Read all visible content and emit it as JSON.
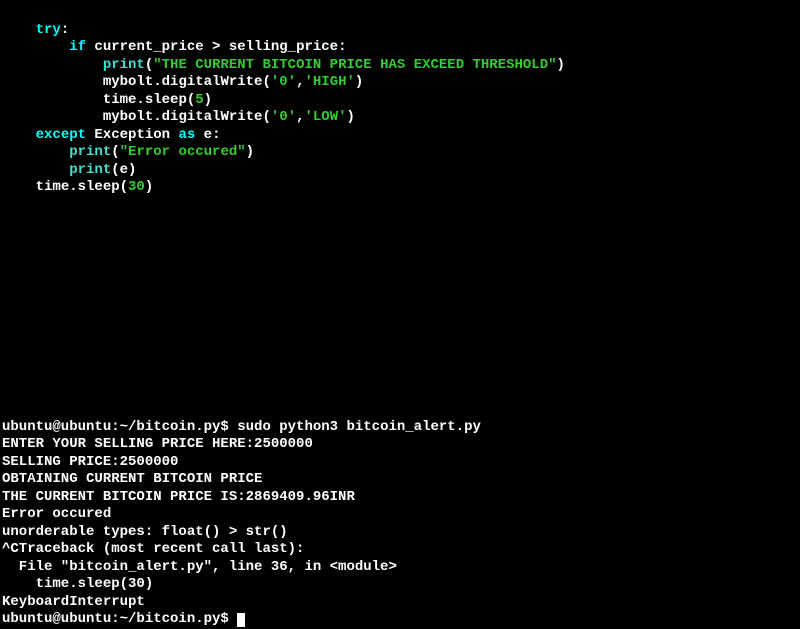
{
  "code": {
    "indent1": "    ",
    "indent2": "        ",
    "indent3": "            ",
    "try": "try",
    "colon": ":",
    "if": "if",
    "cond": " current_price > selling_price:",
    "print": "print",
    "lp": "(",
    "rp": ")",
    "msg": "\"THE CURRENT BITCOIN PRICE HAS EXCEED THRESHOLD\"",
    "dw1a": "mybolt.digitalWrite(",
    "zero": "'0'",
    "comma": ",",
    "high": "'HIGH'",
    "low": "'LOW'",
    "sleep5a": "time.sleep(",
    "five": "5",
    "thirty": "30",
    "except": "except",
    "exc_tail": " Exception ",
    "as": "as",
    "e_tail": " e:",
    "errstr": "\"Error occured\"",
    "e_var": "e"
  },
  "out": {
    "prompt1": "ubuntu@ubuntu:~/bitcoin.py$ ",
    "cmd": "sudo python3 bitcoin_alert.py",
    "l1": "ENTER YOUR SELLING PRICE HERE:2500000",
    "l2": "SELLING PRICE:2500000",
    "l3": "OBTAINING CURRENT BITCOIN PRICE",
    "l4": "THE CURRENT BITCOIN PRICE IS:2869409.96INR",
    "l5": "Error occured",
    "l6": "unorderable types: float() > str()",
    "l7": "^CTraceback (most recent call last):",
    "l8": "  File \"bitcoin_alert.py\", line 36, in <module>",
    "l9": "    time.sleep(30)",
    "l10": "KeyboardInterrupt",
    "prompt2": "ubuntu@ubuntu:~/bitcoin.py$ "
  }
}
